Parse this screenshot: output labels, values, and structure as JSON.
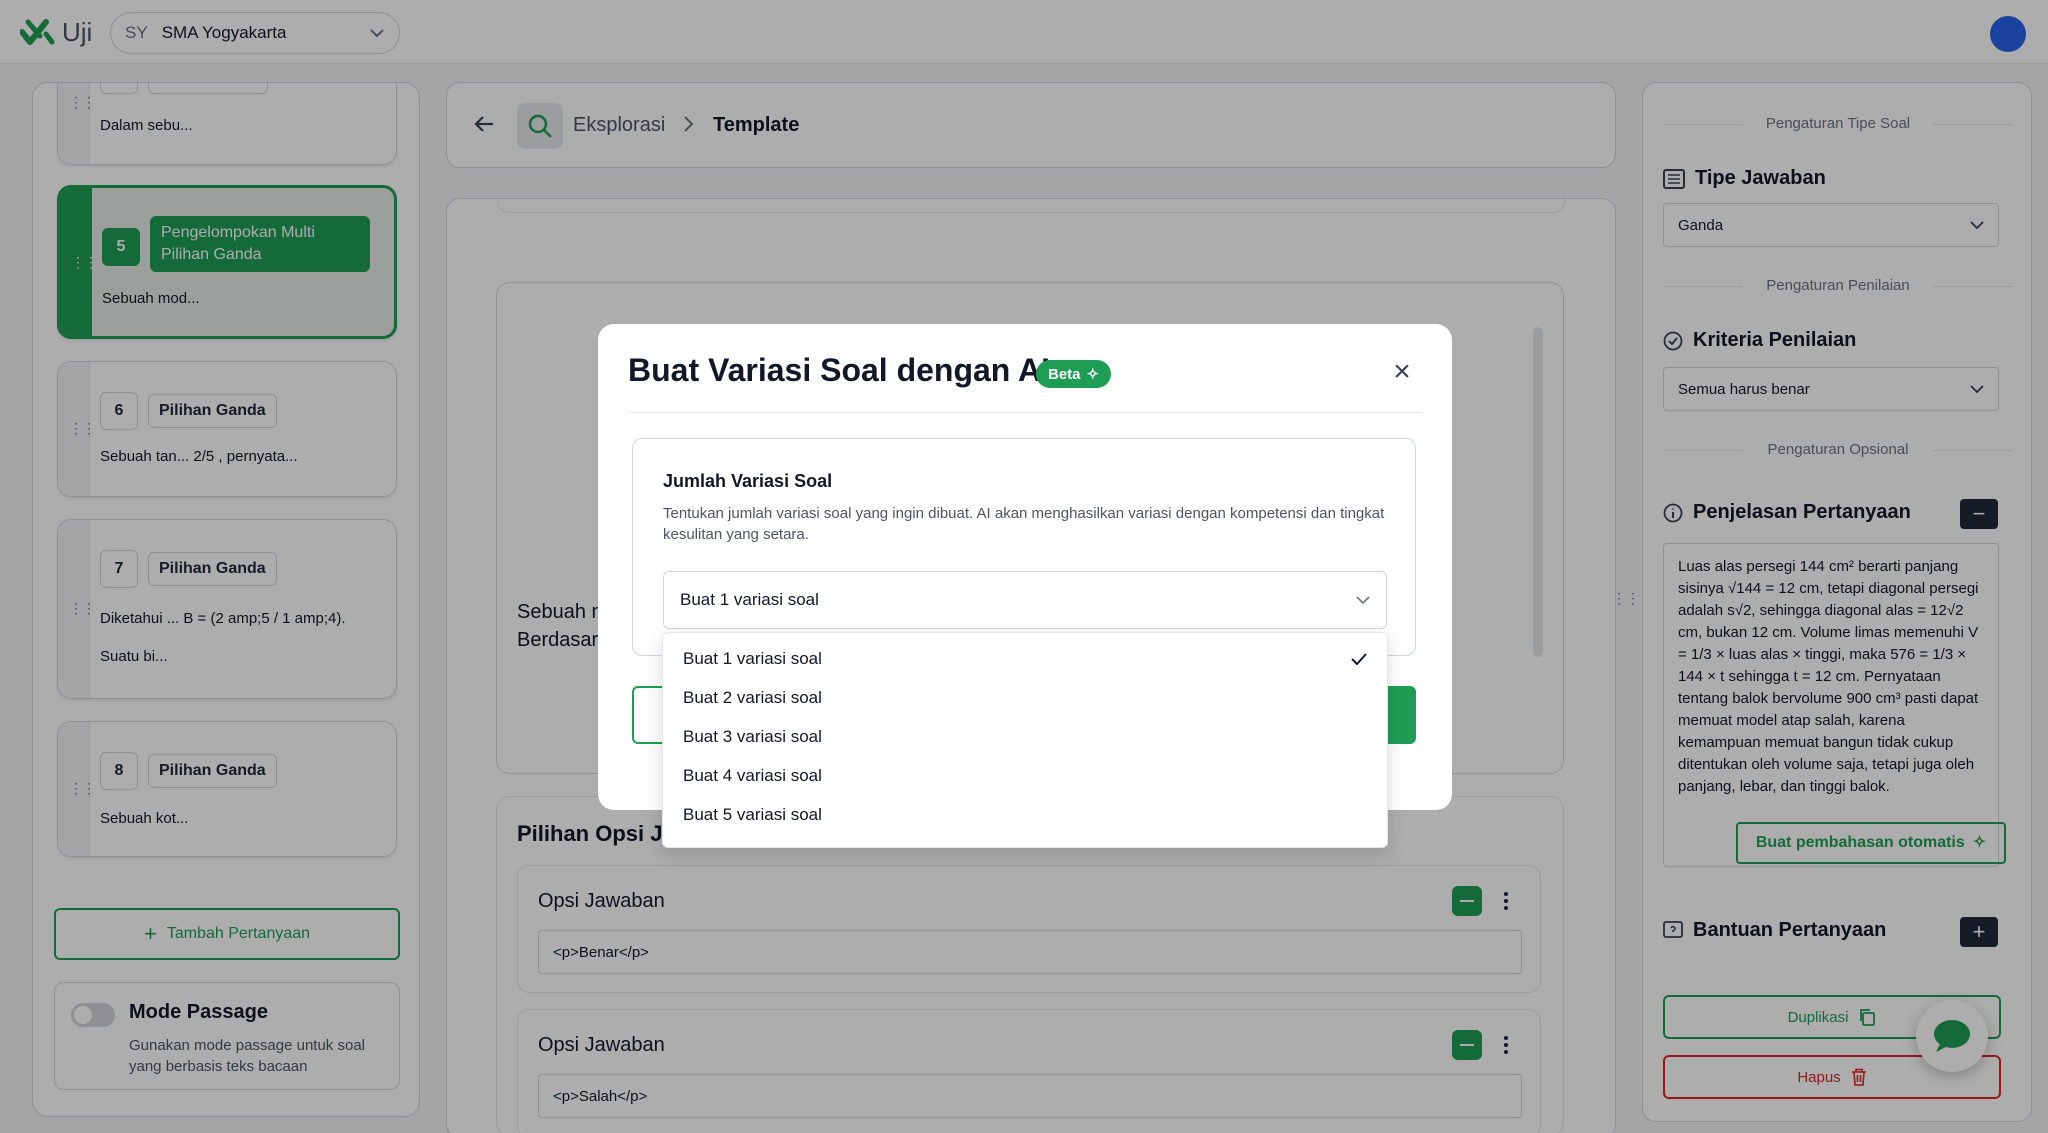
{
  "app": {
    "name": "Uji",
    "school_abbr": "SY",
    "school_name": "SMA Yogyakarta"
  },
  "left": {
    "cards": [
      {
        "num": "",
        "type": "",
        "text": "Dalam sebu..."
      },
      {
        "num": "5",
        "type": "Pengelompokan Multi Pilihan Ganda",
        "text": "Sebuah mod..."
      },
      {
        "num": "6",
        "type": "Pilihan Ganda",
        "text": "Sebuah tan... 2/5 , pernyata..."
      },
      {
        "num": "7",
        "type": "Pilihan Ganda",
        "text": "Diketahui ... B = (2 amp;5 / 1 amp;4).",
        "text2": "Suatu bi..."
      },
      {
        "num": "8",
        "type": "Pilihan Ganda",
        "text": "Sebuah kot..."
      }
    ],
    "add_button": "Tambah Pertanyaan",
    "passage_title": "Mode Passage",
    "passage_desc": "Gunakan mode passage untuk soal yang berbasis teks bacaan"
  },
  "center": {
    "breadcrumb_1": "Eksplorasi",
    "breadcrumb_2": "Template",
    "question_partial_1": "Sebuah m",
    "question_partial_2": "Berdasar",
    "options_title": "Pilihan Opsi J",
    "options": [
      {
        "label": "Opsi Jawaban",
        "value": "<p>Benar</p>"
      },
      {
        "label": "Opsi Jawaban",
        "value": "<p>Salah</p>"
      }
    ]
  },
  "right": {
    "section_type": "Pengaturan Tipe Soal",
    "answer_type_label": "Tipe Jawaban",
    "answer_type_value": "Ganda",
    "section_grading": "Pengaturan Penilaian",
    "criteria_label": "Kriteria Penilaian",
    "criteria_value": "Semua harus benar",
    "section_optional": "Pengaturan Opsional",
    "explanation_label": "Penjelasan Pertanyaan",
    "explanation_text": "Luas alas persegi 144 cm² berarti panjang sisinya √144 = 12 cm, tetapi diagonal persegi adalah s√2, sehingga diagonal alas = 12√2 cm, bukan 12 cm. Volume limas memenuhi V = 1/3 × luas alas × tinggi, maka 576 = 1/3 × 144 × t sehingga t = 12 cm. Pernyataan tentang balok bervolume 900 cm³ pasti dapat memuat model atap salah, karena kemampuan memuat bangun tidak cukup ditentukan oleh volume saja, tetapi juga oleh panjang, lebar, dan tinggi balok.",
    "auto_explain_button": "Buat pembahasan otomatis",
    "help_label": "Bantuan Pertanyaan",
    "duplicate_button": "Duplikasi",
    "delete_button": "Hapus"
  },
  "modal": {
    "title": "Buat Variasi Soal dengan AI",
    "badge": "Beta",
    "field_label": "Jumlah Variasi Soal",
    "field_desc": "Tentukan jumlah variasi soal yang ingin dibuat. AI akan menghasilkan variasi dengan kompetensi dan tingkat kesulitan yang setara.",
    "selected": "Buat 1 variasi soal",
    "options": [
      "Buat 1 variasi soal",
      "Buat 2 variasi soal",
      "Buat 3 variasi soal",
      "Buat 4 variasi soal",
      "Buat 5 variasi soal"
    ]
  },
  "colors": {
    "primary": "#1f9d55",
    "danger": "#dc2626",
    "dark": "#1f2937"
  }
}
